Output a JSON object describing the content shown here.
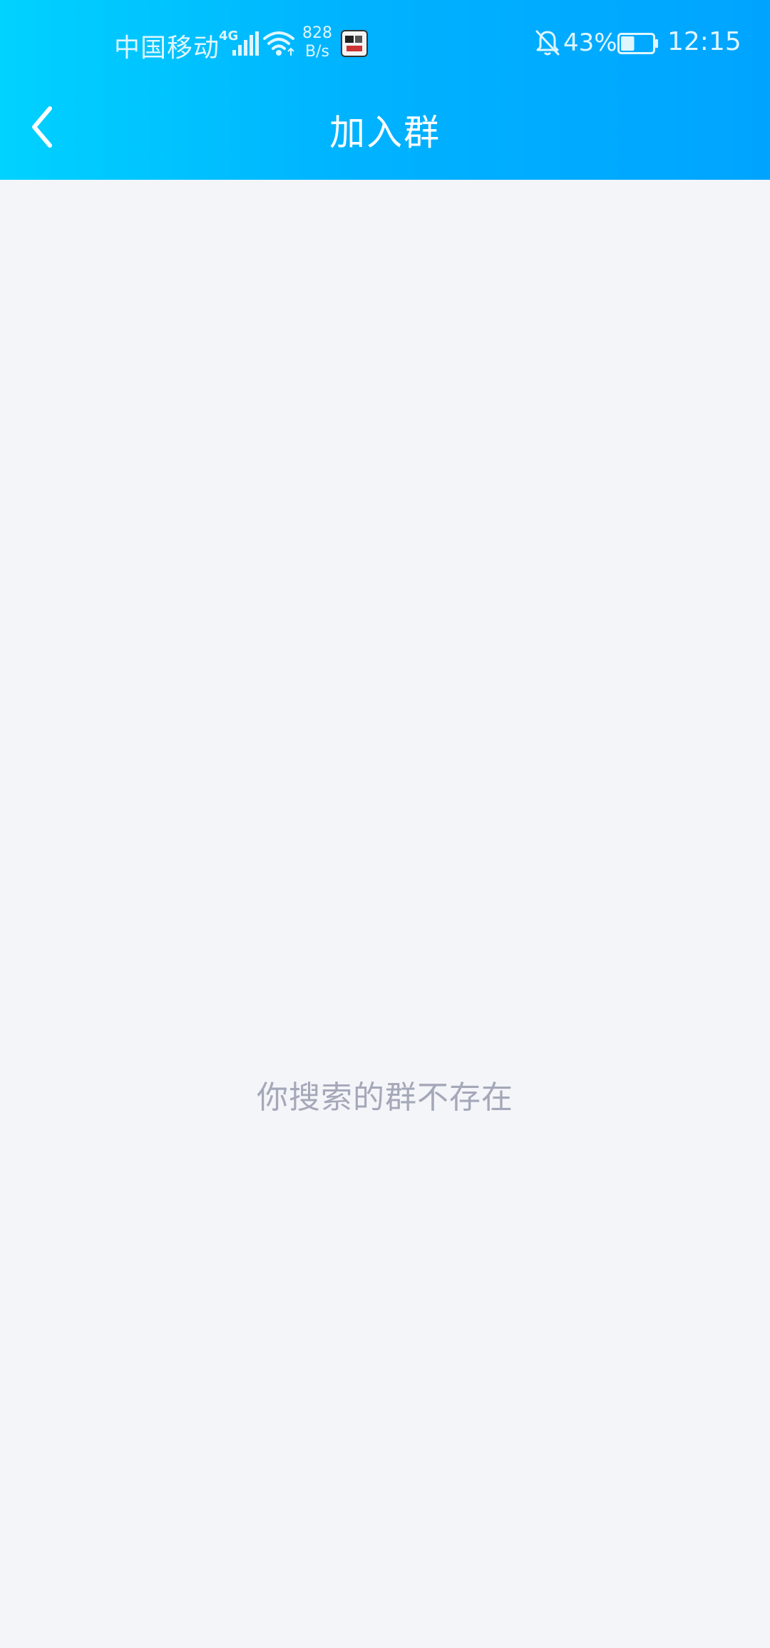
{
  "status_bar": {
    "carrier": "中国移动",
    "network_type": "4G",
    "net_speed_value": "828",
    "net_speed_unit": "B/s",
    "battery_percent": "43%",
    "battery_level": 0.43,
    "time": "12:15",
    "icons": [
      "signal-icon",
      "wifi-icon",
      "app-notification-icon",
      "bell-off-icon",
      "battery-icon"
    ]
  },
  "header": {
    "title": "加入群",
    "back_icon": "chevron-left-icon",
    "gradient_start": "#00d2ff",
    "gradient_end": "#00a4ff"
  },
  "content": {
    "empty_message": "你搜索的群不存在",
    "background": "#f3f5f9"
  }
}
